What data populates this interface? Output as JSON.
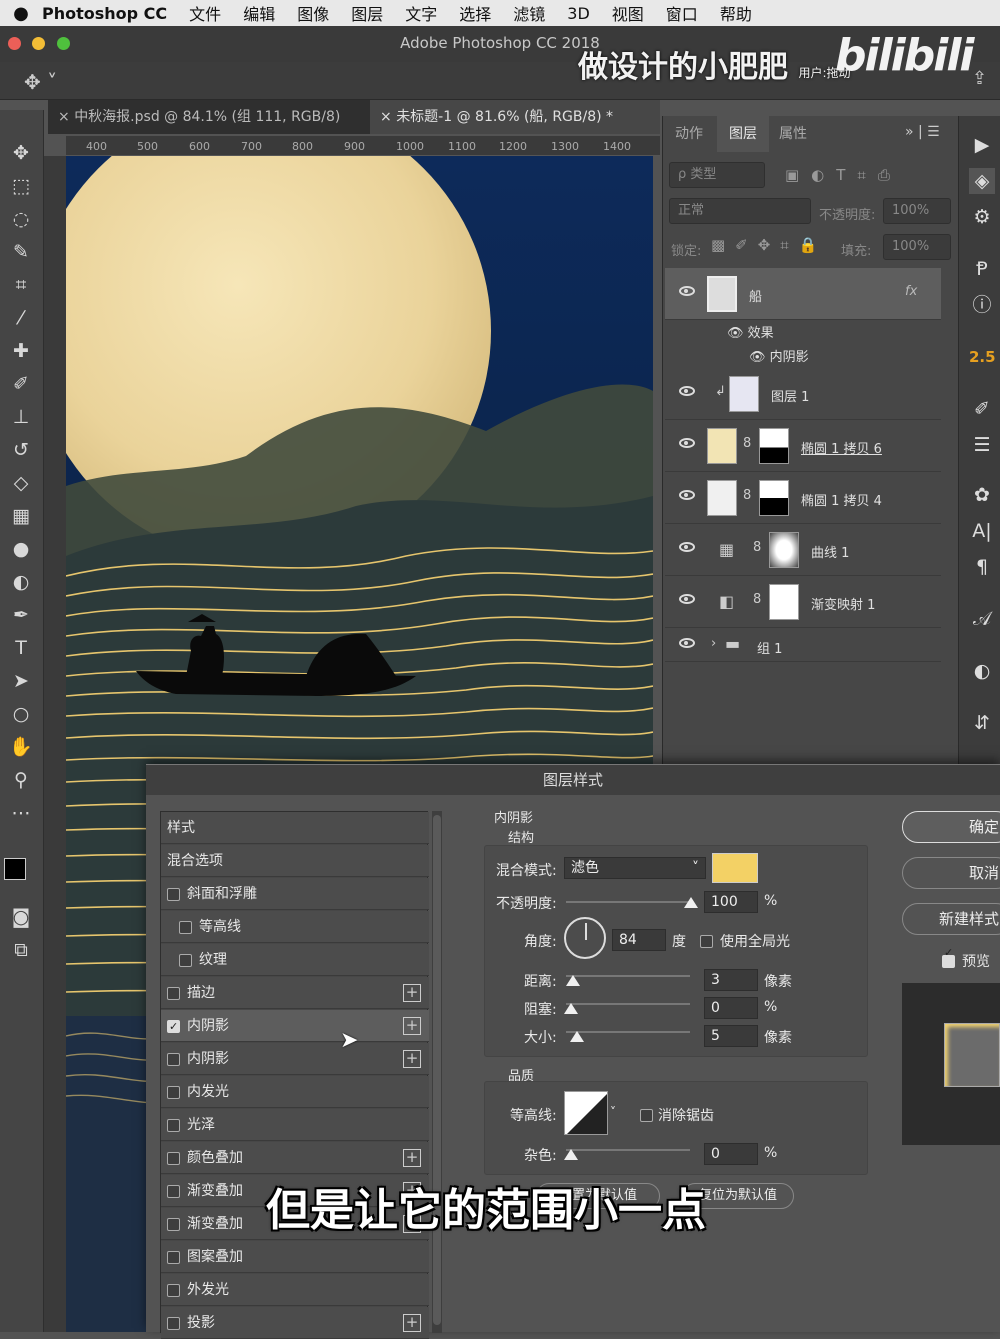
{
  "menubar": {
    "app": "Photoshop CC",
    "items": [
      "文件",
      "编辑",
      "图像",
      "图层",
      "文字",
      "选择",
      "滤镜",
      "3D",
      "视图",
      "窗口",
      "帮助"
    ]
  },
  "window": {
    "title": "Adobe Photoshop CC 2018"
  },
  "watermark": {
    "text": "做设计的小肥肥",
    "overlay": "用户:拖动",
    "logo": "bilibili"
  },
  "tabs": [
    {
      "label": "中秋海报.psd @ 84.1% (组 111, RGB/8)",
      "active": false
    },
    {
      "label": "未标题-1 @ 81.6% (船, RGB/8) *",
      "active": true
    }
  ],
  "ruler": {
    "ticks": [
      "400",
      "500",
      "600",
      "700",
      "800",
      "900",
      "1000",
      "1100",
      "1200",
      "1300",
      "1400"
    ]
  },
  "panel": {
    "tabs": [
      "动作",
      "图层",
      "属性"
    ],
    "filter_placeholder": "ρ 类型",
    "blend_mode": "正常",
    "opacity_label": "不透明度:",
    "opacity_value": "100%",
    "lock_label": "锁定:",
    "fill_label": "填充:",
    "fill_value": "100%",
    "layers": [
      {
        "name": "船",
        "fx": "fx"
      },
      {
        "name": "效果"
      },
      {
        "name": "内阴影"
      },
      {
        "name": "图层 1"
      },
      {
        "name": "椭圆 1 拷贝 6"
      },
      {
        "name": "椭圆 1 拷贝 4"
      },
      {
        "name": "曲线 1"
      },
      {
        "name": "渐变映射 1"
      },
      {
        "name": "组 1"
      }
    ]
  },
  "farright": {
    "number": "2.5"
  },
  "dialog": {
    "title": "图层样式",
    "styles_header": "样式",
    "blend_options": "混合选项",
    "styles": [
      {
        "label": "斜面和浮雕",
        "checked": false,
        "plus": false,
        "indent": false
      },
      {
        "label": "等高线",
        "checked": false,
        "plus": false,
        "indent": true
      },
      {
        "label": "纹理",
        "checked": false,
        "plus": false,
        "indent": true
      },
      {
        "label": "描边",
        "checked": false,
        "plus": true,
        "indent": false
      },
      {
        "label": "内阴影",
        "checked": true,
        "plus": true,
        "indent": false
      },
      {
        "label": "内阴影",
        "checked": false,
        "plus": true,
        "indent": false
      },
      {
        "label": "内发光",
        "checked": false,
        "plus": false,
        "indent": false
      },
      {
        "label": "光泽",
        "checked": false,
        "plus": false,
        "indent": false
      },
      {
        "label": "颜色叠加",
        "checked": false,
        "plus": true,
        "indent": false
      },
      {
        "label": "渐变叠加",
        "checked": false,
        "plus": true,
        "indent": false
      },
      {
        "label": "渐变叠加",
        "checked": false,
        "plus": true,
        "indent": false
      },
      {
        "label": "图案叠加",
        "checked": false,
        "plus": false,
        "indent": false
      },
      {
        "label": "外发光",
        "checked": false,
        "plus": false,
        "indent": false
      },
      {
        "label": "投影",
        "checked": false,
        "plus": true,
        "indent": false
      }
    ],
    "section_title": "内阴影",
    "structure": "结构",
    "blend_mode_label": "混合模式:",
    "blend_mode_value": "滤色",
    "shadow_color": "#f3d165",
    "opacity_label": "不透明度:",
    "opacity_value": "100",
    "angle_label": "角度:",
    "angle_value": "84",
    "angle_unit": "度",
    "global_light": "使用全局光",
    "distance_label": "距离:",
    "distance_value": "3",
    "choke_label": "阻塞:",
    "choke_value": "0",
    "size_label": "大小:",
    "size_value": "5",
    "px_unit": "像素",
    "pct_unit": "%",
    "quality": "品质",
    "contour_label": "等高线:",
    "antialias": "消除锯齿",
    "noise_label": "杂色:",
    "noise_value": "0",
    "btn_default_set": "设置为默认值",
    "btn_default_reset": "复位为默认值",
    "ok": "确定",
    "cancel": "取消",
    "new_style": "新建样式",
    "preview": "预览"
  },
  "subtitle": "但是让它的范围小一点"
}
